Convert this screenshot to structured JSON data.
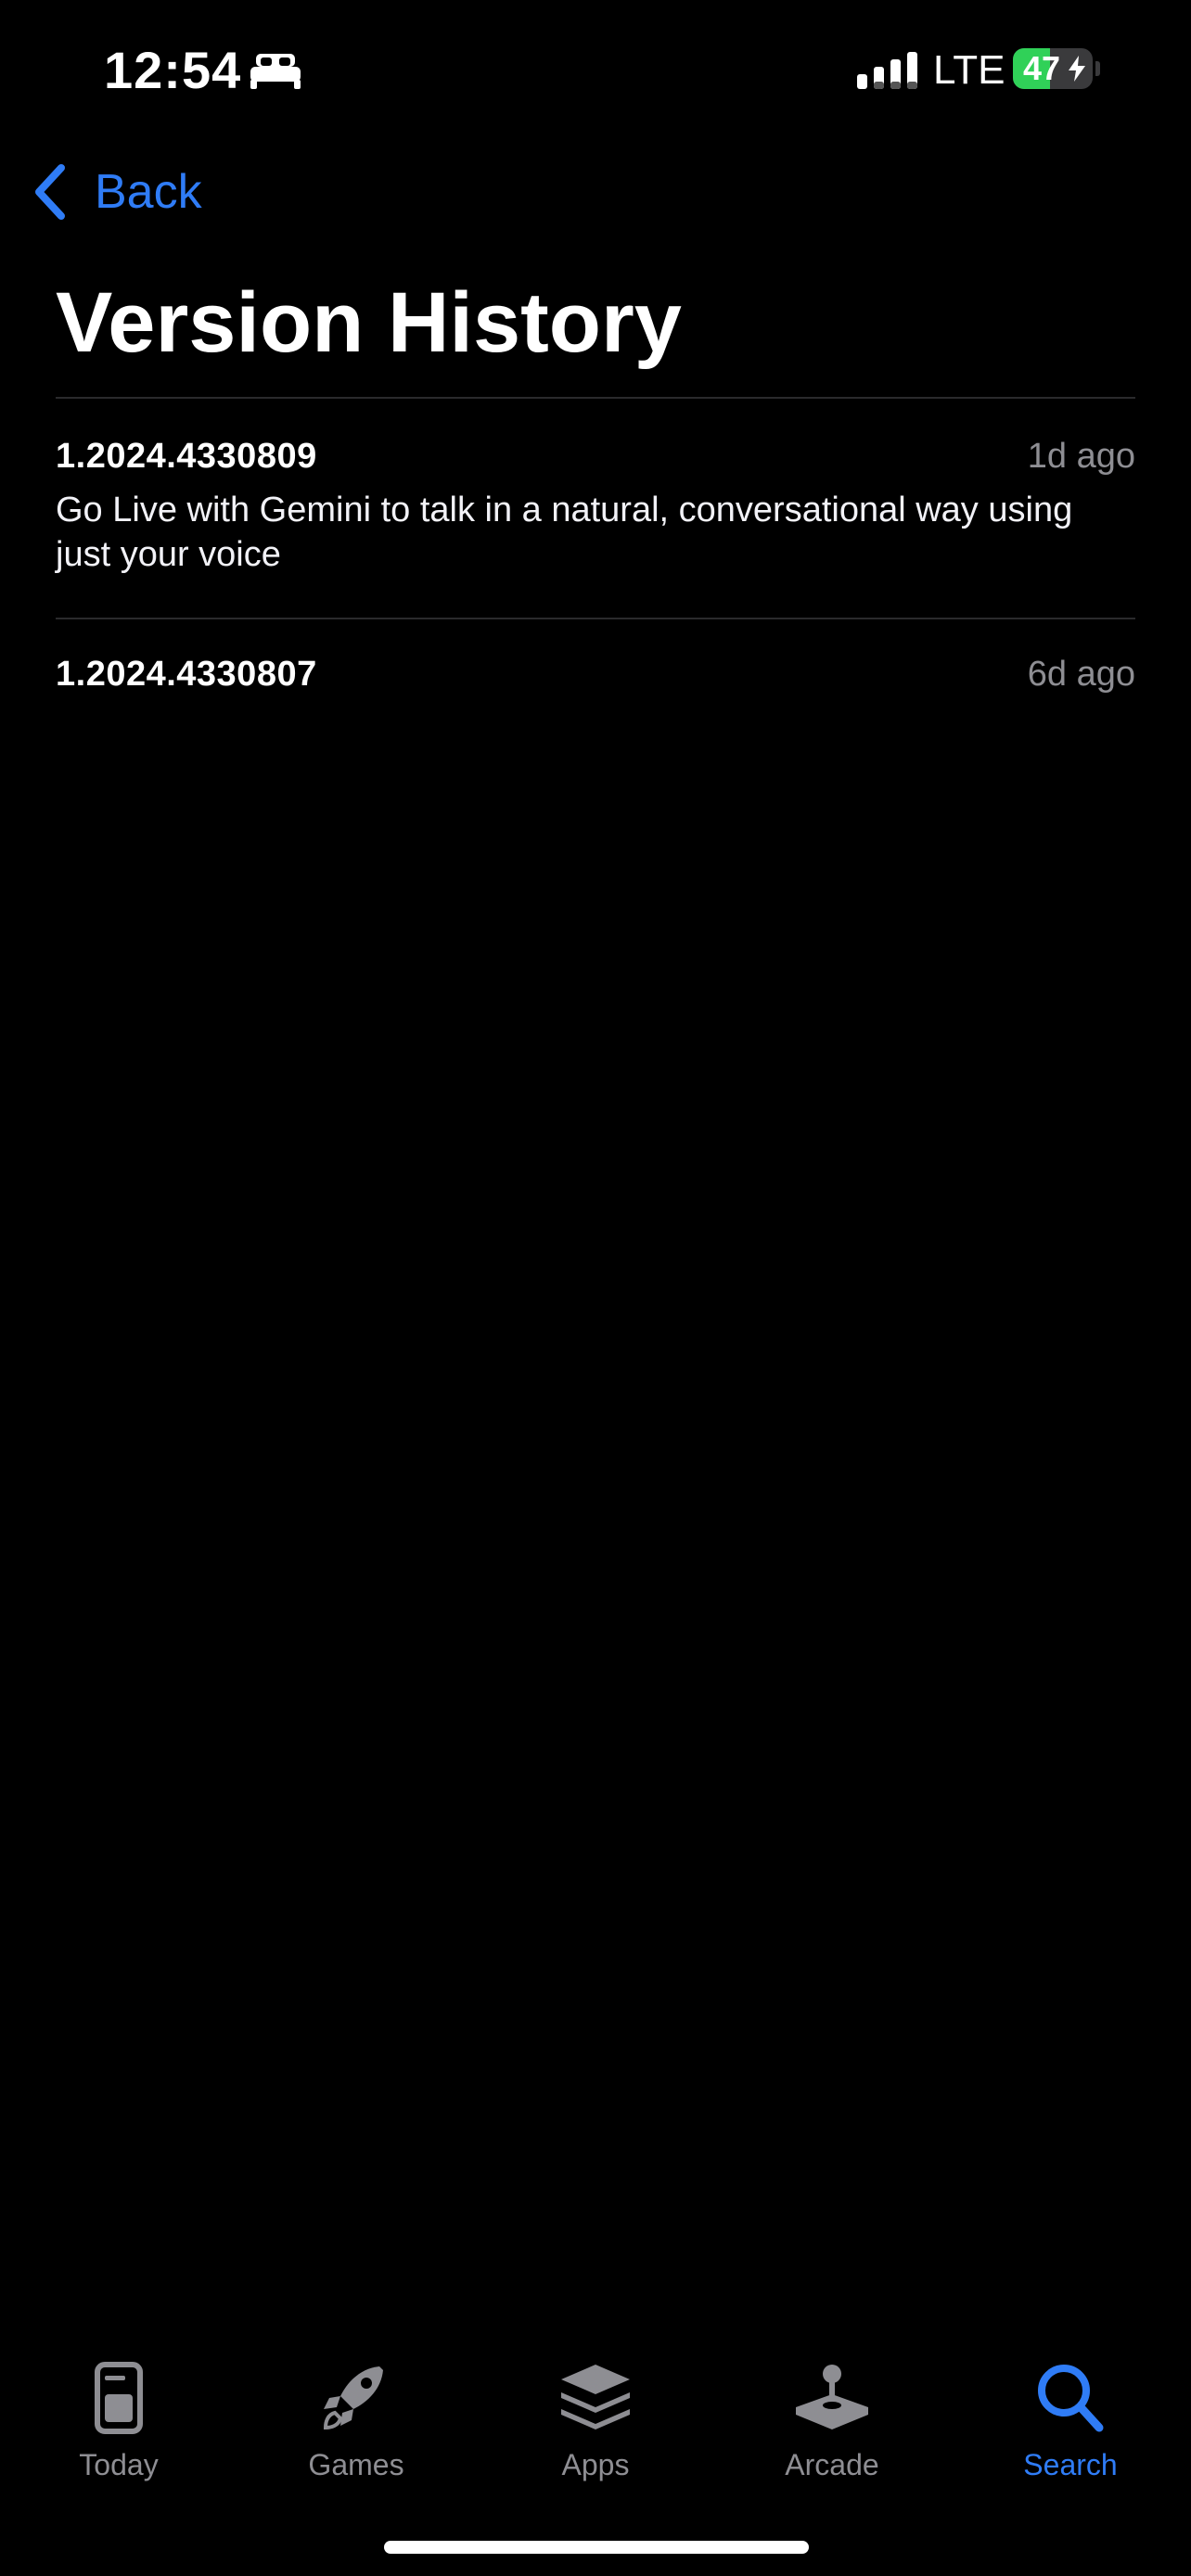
{
  "status_bar": {
    "time": "12:54",
    "network": "LTE",
    "battery_level": "47",
    "battery_fraction": 0.47,
    "icons": [
      "bed-icon",
      "signal-icon",
      "battery-icon",
      "charging-bolt-icon"
    ]
  },
  "nav": {
    "back_label": "Back",
    "back_icon": "chevron-left-icon"
  },
  "page": {
    "title": "Version History"
  },
  "versions": [
    {
      "number": "1.2024.4330809",
      "date": "1d ago",
      "notes": "Go Live with Gemini to talk in a natural, conversational way using just your voice"
    },
    {
      "number": "1.2024.4330807",
      "date": "6d ago",
      "notes": ""
    }
  ],
  "tab_bar": {
    "tabs": [
      {
        "label": "Today",
        "icon": "today-icon",
        "active": false
      },
      {
        "label": "Games",
        "icon": "rocket-icon",
        "active": false
      },
      {
        "label": "Apps",
        "icon": "layers-icon",
        "active": false
      },
      {
        "label": "Arcade",
        "icon": "joystick-icon",
        "active": false
      },
      {
        "label": "Search",
        "icon": "search-icon",
        "active": true
      }
    ]
  },
  "colors": {
    "background": "#000000",
    "accent": "#2f7cf6",
    "secondary_text": "#8e8e93",
    "battery_green": "#30d158",
    "divider": "#2a2a2c"
  }
}
